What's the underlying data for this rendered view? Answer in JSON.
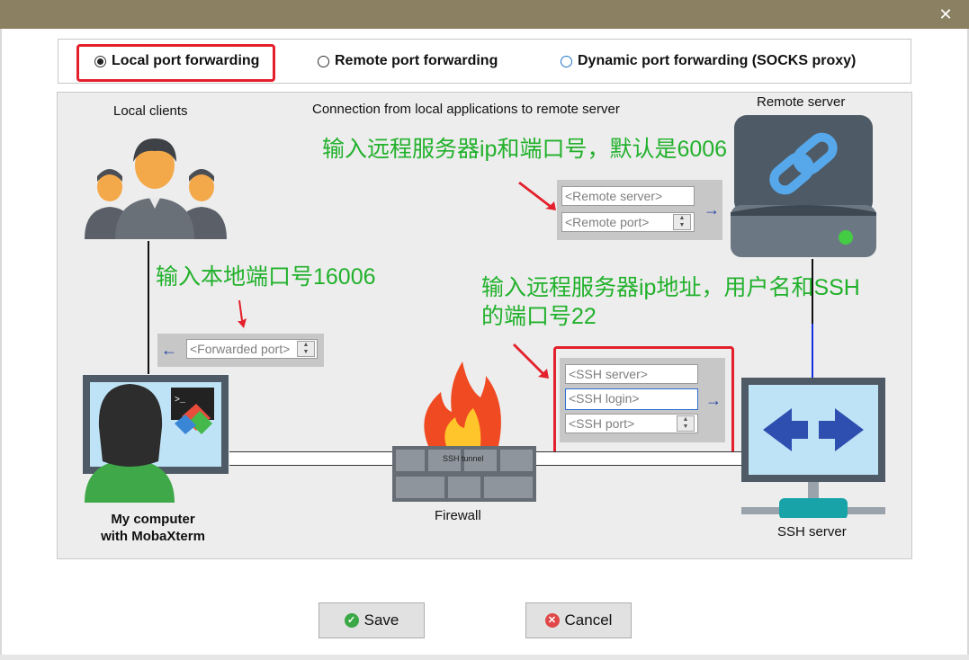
{
  "window": {
    "close_icon": "close-icon"
  },
  "radios": {
    "local": {
      "label": "Local port forwarding",
      "checked": true
    },
    "remote": {
      "label": "Remote port forwarding",
      "checked": false
    },
    "dynamic": {
      "label": "Dynamic port forwarding (SOCKS proxy)",
      "checked": false
    }
  },
  "diagram": {
    "local_clients": "Local clients",
    "description": "Connection from local applications to remote server",
    "remote_server": "Remote server",
    "my_computer_line1": "My computer",
    "my_computer_line2": "with MobaXterm",
    "firewall": "Firewall",
    "ssh_server": "SSH server",
    "ssh_tunnel": "SSH tunnel"
  },
  "fields": {
    "remote_server_placeholder": "<Remote server>",
    "remote_port_placeholder": "<Remote port>",
    "forwarded_port_placeholder": "<Forwarded port>",
    "ssh_server_placeholder": "<SSH server>",
    "ssh_login_placeholder": "<SSH login>",
    "ssh_port_placeholder": "<SSH port>"
  },
  "annotations": {
    "remote_note": "输入远程服务器ip和端口号，默认是6006",
    "local_note": "输入本地端口号16006",
    "ssh_note_line1": "输入远程服务器ip地址，用户名和SSH",
    "ssh_note_line2": "的端口号22"
  },
  "buttons": {
    "save": "Save",
    "cancel": "Cancel"
  },
  "colors": {
    "title_bar": "#8b8061",
    "annotation_green": "#22b12c",
    "highlight_red": "#e3202b",
    "save_green": "#3aa845",
    "cancel_red": "#e04848"
  }
}
